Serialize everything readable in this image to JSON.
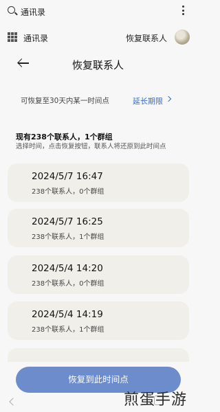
{
  "search": {
    "label": "通讯录"
  },
  "app_bar": {
    "title": "通讯录",
    "restore_label": "恢复联系人",
    "avatar": "user-avatar"
  },
  "page": {
    "title": "恢复联系人"
  },
  "retention": {
    "text": "可恢复至30天内某一时间点",
    "link": "延长期限"
  },
  "summary": {
    "title": "现有238个联系人，1个群组",
    "hint": "选择时间，点击恢复按钮，联系人将还原到此时间点"
  },
  "backups": [
    {
      "time": "2024/5/7 16:47",
      "meta": "238个联系人，0个群组"
    },
    {
      "time": "2024/5/7 16:25",
      "meta": "238个联系人，1个群组"
    },
    {
      "time": "2024/5/4 14:20",
      "meta": "238个联系人，0个群组"
    },
    {
      "time": "2024/5/4 14:19",
      "meta": "238个联系人，1个群组"
    }
  ],
  "button": {
    "label": "恢复到此时间点"
  },
  "watermark": "煎蛋手游",
  "colors": {
    "accent": "#3a6cc4",
    "button": "#6d8ccc",
    "card": "#f0efea",
    "background": "#f7f7f7"
  }
}
